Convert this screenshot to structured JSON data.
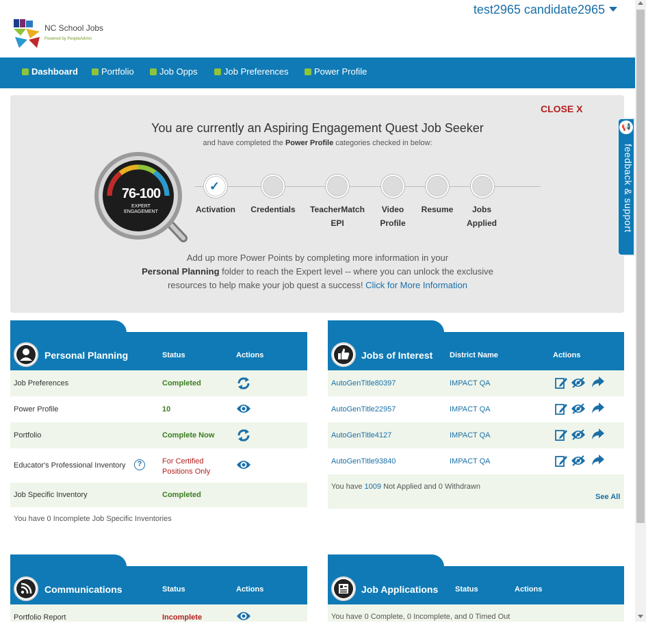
{
  "header": {
    "brand_name": "NC School Jobs",
    "brand_powered": "Powered by PeopleAdmin",
    "user_name": "test2965 candidate2965"
  },
  "nav": {
    "items": [
      {
        "label": "Dashboard"
      },
      {
        "label": "Portfolio"
      },
      {
        "label": "Job Opps"
      },
      {
        "label": "Job Preferences"
      },
      {
        "label": "Power Profile"
      }
    ]
  },
  "feedback": {
    "label": "feedback & support"
  },
  "engagement": {
    "close_label": "CLOSE X",
    "title": "You are currently an Aspiring Engagement Quest Job Seeker",
    "subtitle_pre": "and have completed the ",
    "subtitle_bold": "Power Profile",
    "subtitle_post": " categories checked in below:",
    "gauge_range": "76-100",
    "gauge_line1": "EXPERT",
    "gauge_line2": "ENGAGEMENT",
    "steps": [
      {
        "label": "Activation",
        "label2": ""
      },
      {
        "label": "Credentials",
        "label2": ""
      },
      {
        "label": "TeacherMatch",
        "label2": "EPI"
      },
      {
        "label": "Video",
        "label2": "Profile"
      },
      {
        "label": "Resume",
        "label2": ""
      },
      {
        "label": "Jobs",
        "label2": "Applied"
      }
    ],
    "completed_steps": 1,
    "info_line1": "Add up more Power Points by completing more information in your",
    "info_line2_bold": "Personal Planning",
    "info_line2_rest": " folder to reach the Expert level -- where you can unlock the exclusive",
    "info_line3": "resources to help make your job quest a success! ",
    "info_link": "Click for More Information"
  },
  "personal_planning": {
    "title": "Personal Planning",
    "col_status": "Status",
    "col_actions": "Actions",
    "rows": [
      {
        "name": "Job Preferences",
        "status": "Completed",
        "action_icon": "refresh-icon"
      },
      {
        "name": "Power Profile",
        "status": "10",
        "action_icon": "eye-icon"
      },
      {
        "name": "Portfolio",
        "status": "Complete Now",
        "action_icon": "refresh-icon"
      },
      {
        "name": "Educator's Professional Inventory",
        "status_line1": "For Certified",
        "status_line2": "Positions Only",
        "action_icon": "eye-icon"
      },
      {
        "name": "Job Specific Inventory",
        "status": "Completed"
      }
    ],
    "note": "You have 0 Incomplete Job Specific Inventories"
  },
  "jobs_of_interest": {
    "title": "Jobs of Interest",
    "col_district": "District Name",
    "col_actions": "Actions",
    "rows": [
      {
        "title": "AutoGenTitle80397",
        "district": "IMPACT QA"
      },
      {
        "title": "AutoGenTitle22957",
        "district": "IMPACT QA"
      },
      {
        "title": "AutoGenTitle4127",
        "district": "IMPACT QA"
      },
      {
        "title": "AutoGenTitle93840",
        "district": "IMPACT QA"
      }
    ],
    "note_pre": "You have ",
    "note_num": "1009",
    "note_post": " Not Applied and 0 Withdrawn",
    "see_all": "See All"
  },
  "communications": {
    "title": "Communications",
    "col_status": "Status",
    "col_actions": "Actions",
    "rows": [
      {
        "name": "Portfolio Report",
        "status": "Incomplete",
        "action_icon": "eye-icon"
      }
    ]
  },
  "job_applications": {
    "title": "Job Applications",
    "col_status": "Status",
    "col_actions": "Actions",
    "note": "You have 0 Complete, 0 Incomplete, and 0 Timed Out"
  },
  "colors": {
    "brand_blue": "#0f7ab5",
    "nav_green": "#8fc43a",
    "status_green": "#3a7d22",
    "status_red": "#b41e1e",
    "row_tint": "#eff5ea"
  }
}
